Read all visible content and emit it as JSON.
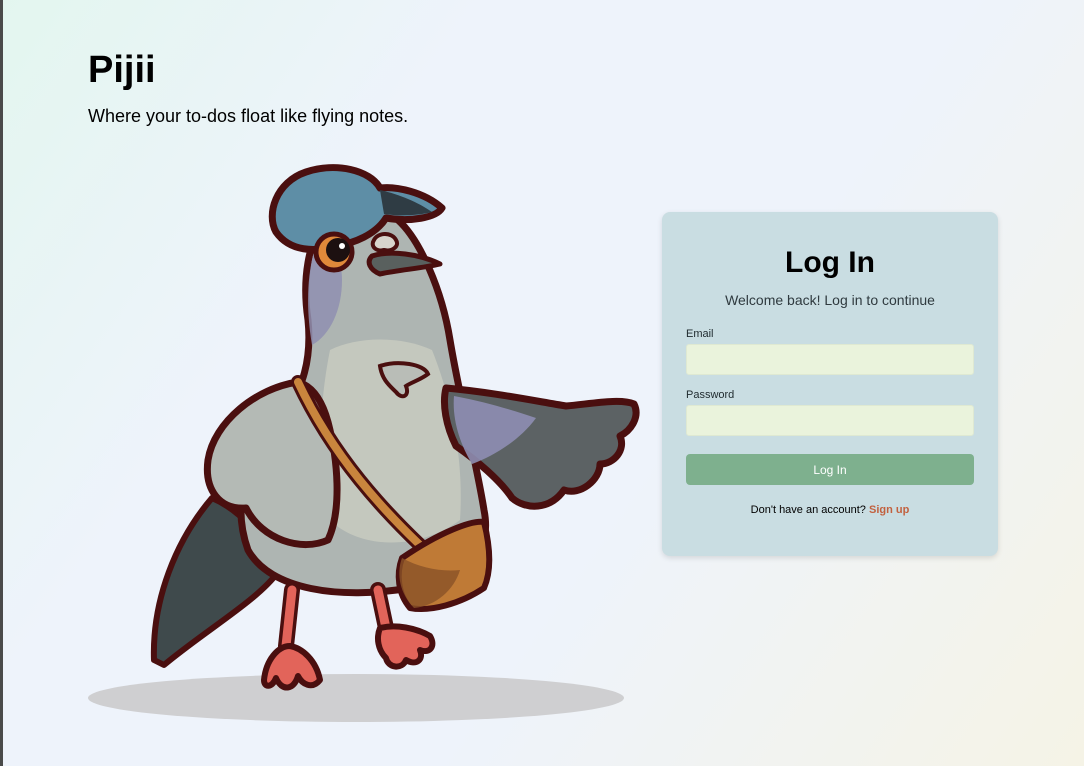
{
  "brand": {
    "title": "Pijii",
    "tagline": "Where your to-dos float like flying notes."
  },
  "mascot": {
    "icon": "pigeon-mail-carrier-icon"
  },
  "login": {
    "title": "Log In",
    "subtitle": "Welcome back! Log in to continue",
    "email_label": "Email",
    "email_value": "",
    "password_label": "Password",
    "password_value": "",
    "submit_label": "Log In",
    "signup_prompt": "Don't have an account?",
    "signup_link": "Sign up"
  },
  "colors": {
    "card_bg": "#c9dde2",
    "input_bg": "#eaf3dc",
    "button_bg": "#7eb08e",
    "link": "#c2613f"
  }
}
